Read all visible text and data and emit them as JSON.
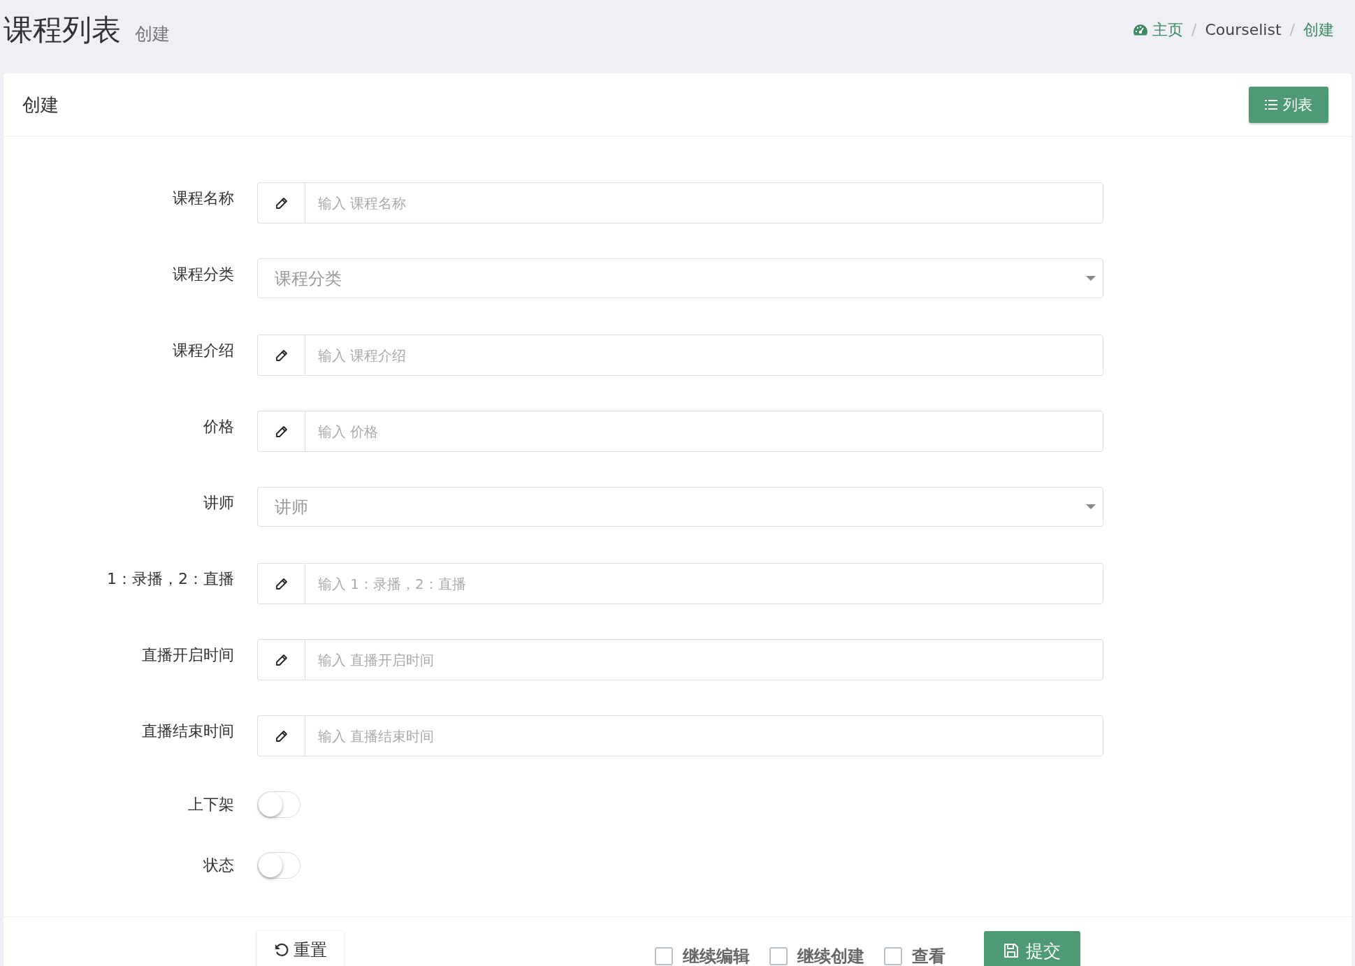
{
  "page_header": {
    "title": "课程列表",
    "subtitle": "创建"
  },
  "breadcrumb": [
    {
      "label": "主页",
      "kind": "home"
    },
    {
      "label": "/",
      "kind": "separator"
    },
    {
      "label": "Courselist",
      "kind": "plain"
    },
    {
      "label": "/",
      "kind": "separator"
    },
    {
      "label": "创建",
      "kind": "current"
    }
  ],
  "card": {
    "title": "创建",
    "list_button": "列表"
  },
  "fields": [
    {
      "kind": "text",
      "label": "课程名称",
      "placeholder": "输入 课程名称"
    },
    {
      "kind": "select",
      "label": "课程分类",
      "placeholder": "课程分类"
    },
    {
      "kind": "text",
      "label": "课程介绍",
      "placeholder": "输入 课程介绍"
    },
    {
      "kind": "text",
      "label": "价格",
      "placeholder": "输入 价格"
    },
    {
      "kind": "select",
      "label": "讲师",
      "placeholder": "讲师"
    },
    {
      "kind": "text",
      "label": "1：录播，2：直播",
      "placeholder": "输入 1：录播，2：直播"
    },
    {
      "kind": "text",
      "label": "直播开启时间",
      "placeholder": "输入 直播开启时间"
    },
    {
      "kind": "text",
      "label": "直播结束时间",
      "placeholder": "输入 直播结束时间"
    },
    {
      "kind": "switch",
      "label": "上下架",
      "on": false
    },
    {
      "kind": "switch",
      "label": "状态",
      "on": false
    }
  ],
  "footer": {
    "reset_button": "重置",
    "options": [
      {
        "label": "继续编辑",
        "checked": false
      },
      {
        "label": "继续创建",
        "checked": false
      },
      {
        "label": "查看",
        "checked": false
      }
    ],
    "submit_button": "提交"
  }
}
